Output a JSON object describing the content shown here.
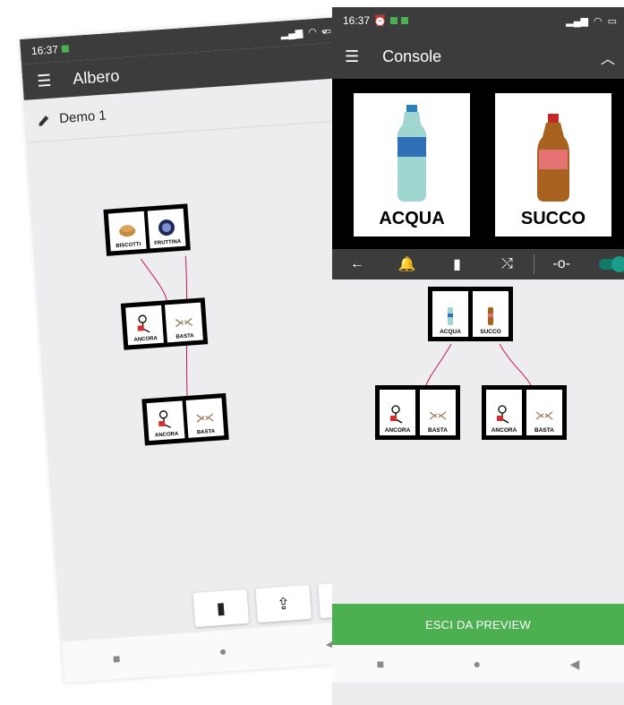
{
  "left_screen": {
    "status_time": "16:37",
    "app_title": "Albero",
    "doc_name": "Demo 1",
    "root_tiles": [
      "BISCOTTI",
      "FRUTTINA"
    ],
    "child_tiles_a": [
      "ANCORA",
      "BASTA"
    ],
    "child_tiles_b": [
      "ANCORA",
      "BASTA"
    ]
  },
  "right_screen": {
    "status_time": "16:37",
    "app_title": "Console",
    "big_cards": [
      "ACQUA",
      "SUCCO"
    ],
    "root_tiles": [
      "ACQUA",
      "SUCCO"
    ],
    "child_tiles_a": [
      "ANCORA",
      "BASTA"
    ],
    "child_tiles_b": [
      "ANCORA",
      "BASTA"
    ],
    "exit_button": "ESCI DA PREVIEW"
  },
  "colors": {
    "appbar": "#3c3c3c",
    "exit_green": "#4caf50",
    "toggle_teal": "#1a9d8a",
    "link_line": "#c2185b"
  },
  "icons": [
    "menu-icon",
    "pencil-icon",
    "chevron-down-icon",
    "chevron-up-icon",
    "new-file-icon",
    "share-icon",
    "eye-icon",
    "back-arrow-icon",
    "bell-icon",
    "bookmark-icon",
    "shuffle-icon",
    "slider-icon",
    "toggle-switch",
    "nav-square-icon",
    "nav-circle-icon",
    "nav-back-icon"
  ]
}
